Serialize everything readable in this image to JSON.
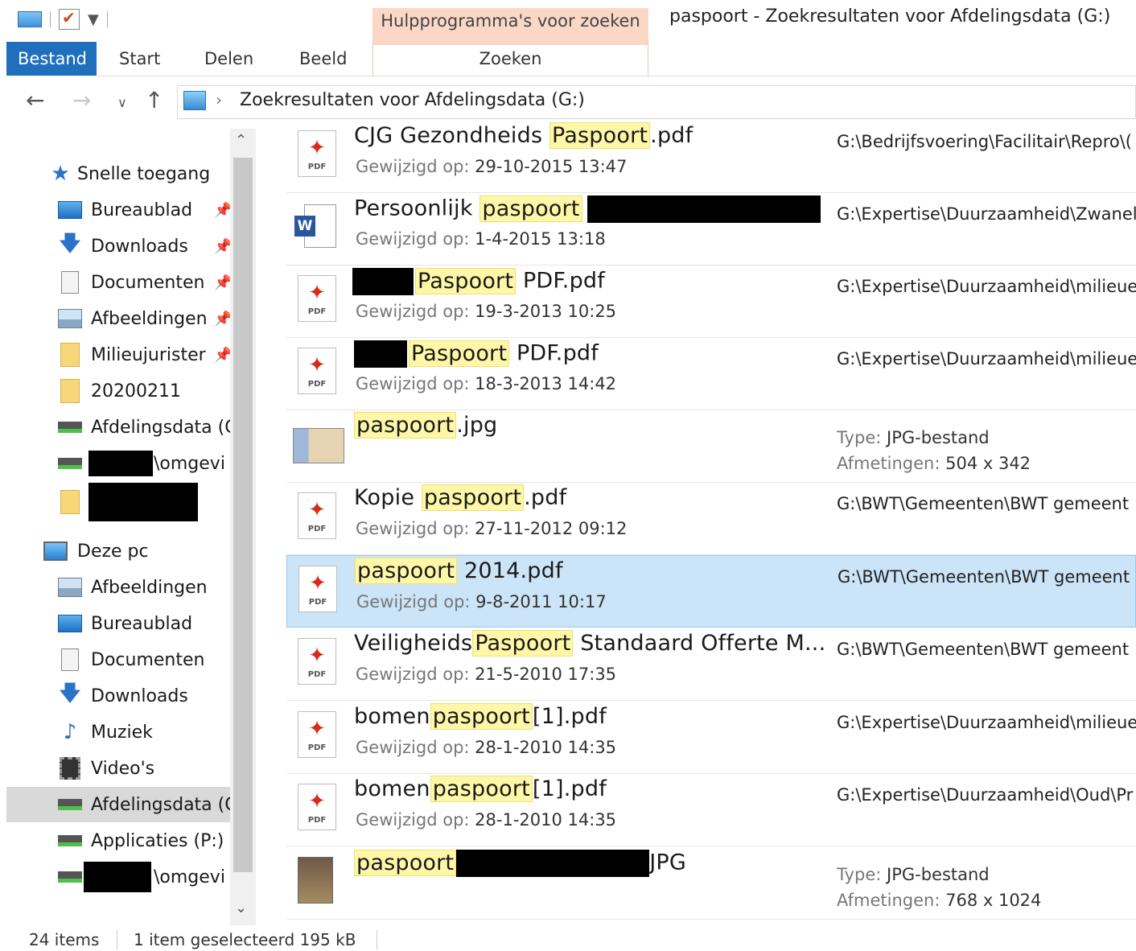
{
  "titlebar": {
    "contextual_tab_title": "Hulpprogramma's voor zoeken",
    "window_title": "paspoort - Zoekresultaten voor Afdelingsdata (G:)"
  },
  "ribbon": {
    "tabs": [
      "Bestand",
      "Start",
      "Delen",
      "Beeld",
      "Zoeken"
    ],
    "active_tab": "Bestand",
    "accent": "#1f6fbd"
  },
  "address": {
    "path": "Zoekresultaten voor Afdelingsdata (G:)",
    "chevron": "›"
  },
  "nav": {
    "quick_access": "Snelle toegang",
    "quick_items": [
      {
        "label": "Bureaublad",
        "icon": "desktop-icon"
      },
      {
        "label": "Downloads",
        "icon": "download-icon"
      },
      {
        "label": "Documenten",
        "icon": "document-icon"
      },
      {
        "label": "Afbeeldingen",
        "icon": "pictures-icon"
      },
      {
        "label": "Milieujurister",
        "icon": "folder-icon"
      },
      {
        "label": "20200211",
        "icon": "folder-icon"
      },
      {
        "label": "Afdelingsdata (G",
        "icon": "drive-icon"
      },
      {
        "label": "\\omgevi",
        "icon": "drive-icon"
      }
    ],
    "this_pc": "Deze pc",
    "pc_items": [
      {
        "label": "Afbeeldingen",
        "icon": "pictures-icon"
      },
      {
        "label": "Bureaublad",
        "icon": "desktop-icon"
      },
      {
        "label": "Documenten",
        "icon": "document-icon"
      },
      {
        "label": "Downloads",
        "icon": "download-icon"
      },
      {
        "label": "Muziek",
        "icon": "music-icon"
      },
      {
        "label": "Video's",
        "icon": "video-icon"
      },
      {
        "label": "Afdelingsdata (G",
        "icon": "drive-icon"
      },
      {
        "label": "Applicaties (P:)",
        "icon": "drive-icon"
      },
      {
        "label": "\\omgevi",
        "icon": "drive-icon"
      }
    ]
  },
  "results": {
    "meta_label": "Gewijzigd op:",
    "type_label": "Type:",
    "dims_label": "Afmetingen:",
    "items": [
      {
        "pre": "CJG Gezondheids ",
        "hl": "Paspoort",
        "post": ".pdf",
        "date": "29-10-2015 13:47",
        "path": "G:\\Bedrijfsvoering\\Facilitair\\Repro\\("
      },
      {
        "pre": "Persoonlijk ",
        "hl": "paspoort",
        "post": "",
        "date": "1-4-2015 13:18",
        "path": "G:\\Expertise\\Duurzaamheid\\Zwanel"
      },
      {
        "pre": "",
        "hl": "Paspoort",
        "post": " PDF.pdf",
        "date": "19-3-2013 10:25",
        "path": "G:\\Expertise\\Duurzaamheid\\milieue"
      },
      {
        "pre": "",
        "hl": "Paspoort",
        "post": " PDF.pdf",
        "date": "18-3-2013 14:42",
        "path": "G:\\Expertise\\Duurzaamheid\\milieue"
      },
      {
        "pre": "",
        "hl": "paspoort",
        "post": ".jpg",
        "type": "JPG-bestand",
        "dims": "504 x 342"
      },
      {
        "pre": "Kopie ",
        "hl": "paspoort",
        "post": ".pdf",
        "date": "27-11-2012 09:12",
        "path": "G:\\BWT\\Gemeenten\\BWT gemeent"
      },
      {
        "pre": "",
        "hl": "paspoort",
        "post": " 2014.pdf",
        "date": "9-8-2011 10:17",
        "path": "G:\\BWT\\Gemeenten\\BWT gemeent"
      },
      {
        "pre": "Veiligheids",
        "hl": "Paspoort",
        "post": " Standaard Offerte M...",
        "date": "21-5-2010 17:35",
        "path": "G:\\BWT\\Gemeenten\\BWT gemeent"
      },
      {
        "pre": "bomen",
        "hl": "paspoort",
        "post": "[1].pdf",
        "date": "28-1-2010 14:35",
        "path": "G:\\Expertise\\Duurzaamheid\\milieue"
      },
      {
        "pre": "bomen",
        "hl": "paspoort",
        "post": "[1].pdf",
        "date": "28-1-2010 14:35",
        "path": "G:\\Expertise\\Duurzaamheid\\Oud\\Pr"
      },
      {
        "pre": "",
        "hl": "paspoort",
        "post": "JPG",
        "type": "JPG-bestand",
        "dims": "768 x 1024"
      }
    ]
  },
  "status": {
    "count": "24 items",
    "selection": "1 item geselecteerd  195 kB"
  },
  "colors": {
    "highlight": "#fff7a8",
    "selection": "#cce4f7",
    "context_tab": "#fbd8c6"
  }
}
